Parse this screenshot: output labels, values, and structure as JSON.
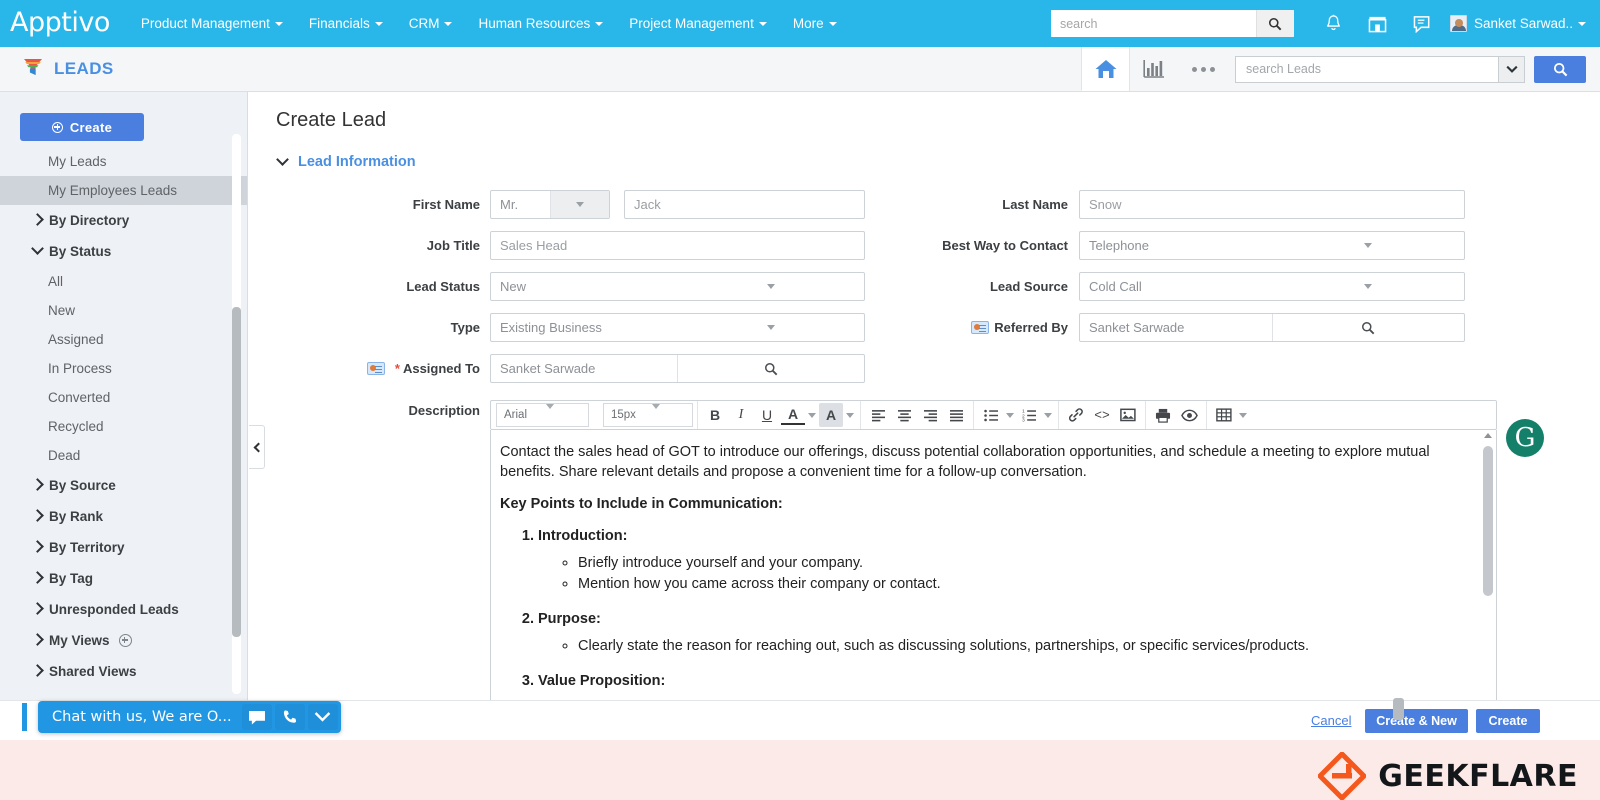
{
  "topnav": {
    "logo": "Apptivo",
    "menu": [
      {
        "label": "Product Management"
      },
      {
        "label": "Financials"
      },
      {
        "label": "CRM"
      },
      {
        "label": "Human Resources"
      },
      {
        "label": "Project Management"
      },
      {
        "label": "More"
      }
    ],
    "search_placeholder": "search",
    "search_value": "",
    "icons": [
      "search-icon",
      "bell-icon",
      "store-icon",
      "feedback-icon"
    ],
    "user_name": "Sanket Sarwad.."
  },
  "modbar": {
    "title": "LEADS",
    "home_icon": "home-icon",
    "reports_icon": "bar-chart-icon",
    "more_icon": "ellipsis-icon",
    "search_placeholder": "search Leads",
    "search_value": ""
  },
  "sidebar": {
    "create_label": "Create",
    "items": [
      {
        "label": "My Leads",
        "type": "leaf",
        "selected": false
      },
      {
        "label": "My Employees Leads",
        "type": "leaf",
        "selected": true
      },
      {
        "label": "By Directory",
        "type": "group",
        "expanded": false
      },
      {
        "label": "By Status",
        "type": "group",
        "expanded": true
      },
      {
        "label": "All",
        "type": "leaf",
        "selected": false
      },
      {
        "label": "New",
        "type": "leaf",
        "selected": false
      },
      {
        "label": "Assigned",
        "type": "leaf",
        "selected": false
      },
      {
        "label": "In Process",
        "type": "leaf",
        "selected": false
      },
      {
        "label": "Converted",
        "type": "leaf",
        "selected": false
      },
      {
        "label": "Recycled",
        "type": "leaf",
        "selected": false
      },
      {
        "label": "Dead",
        "type": "leaf",
        "selected": false
      },
      {
        "label": "By Source",
        "type": "group",
        "expanded": false
      },
      {
        "label": "By Rank",
        "type": "group",
        "expanded": false
      },
      {
        "label": "By Territory",
        "type": "group",
        "expanded": false
      },
      {
        "label": "By Tag",
        "type": "group",
        "expanded": false
      },
      {
        "label": "Unresponded Leads",
        "type": "group",
        "expanded": false
      },
      {
        "label": "My Views",
        "type": "group",
        "expanded": false,
        "add": true
      },
      {
        "label": "Shared Views",
        "type": "group",
        "expanded": false
      }
    ]
  },
  "main": {
    "page_title": "Create Lead",
    "section_title": "Lead Information",
    "fields": {
      "first_name_label": "First Name",
      "salutation_value": "Mr.",
      "first_name_value": "Jack",
      "last_name_label": "Last Name",
      "last_name_value": "Snow",
      "job_title_label": "Job Title",
      "job_title_value": "Sales Head",
      "best_way_label": "Best Way to Contact",
      "best_way_value": "Telephone",
      "lead_status_label": "Lead Status",
      "lead_status_value": "New",
      "lead_source_label": "Lead Source",
      "lead_source_value": "Cold Call",
      "type_label": "Type",
      "type_value": "Existing Business",
      "referred_by_label": "Referred By",
      "referred_by_value": "Sanket Sarwade",
      "assigned_to_label": "Assigned To",
      "assigned_to_value": "Sanket Sarwade",
      "assigned_to_required": "*",
      "description_label": "Description"
    },
    "editor": {
      "font_family_value": "Arial",
      "font_size_value": "15px",
      "buttons": [
        "bold-icon",
        "italic-icon",
        "underline-icon",
        "text-color-icon",
        "highlight-color-icon",
        "align-left-icon",
        "align-center-icon",
        "align-right-icon",
        "align-justify-icon",
        "bulleted-list-icon",
        "numbered-list-icon",
        "link-icon",
        "code-icon",
        "image-icon",
        "print-icon",
        "preview-icon",
        "table-icon"
      ],
      "content": {
        "intro": "Contact the sales head of GOT to introduce our offerings, discuss potential collaboration opportunities, and schedule a meeting to explore mutual benefits. Share relevant details and propose a convenient time for a follow-up conversation.",
        "heading": "Key Points to Include in Communication:",
        "item1_title": "Introduction:",
        "item1_bullets": [
          "Briefly introduce yourself and your company.",
          "Mention how you came across their company or contact."
        ],
        "item2_title": "Purpose:",
        "item2_bullets": [
          "Clearly state the reason for reaching out, such as discussing solutions, partnerships, or specific services/products."
        ],
        "item3_title": "Value Proposition:"
      }
    }
  },
  "footer": {
    "cancel_label": "Cancel",
    "create_new_label": "Create & New",
    "create_label": "Create"
  },
  "chat": {
    "text": "Chat with us, We are O...",
    "icons": [
      "chat-bubble-icon",
      "phone-icon",
      "chevron-down-icon"
    ]
  },
  "overlays": {
    "grammarly_icon": "grammarly-icon",
    "grammarly_letter": "G",
    "brand_name": "GEEKFLARE"
  },
  "colors": {
    "topnav_bg": "#29b6e8",
    "accent_blue": "#4a7fe0",
    "link_blue": "#4a90e2",
    "sidebar_bg": "#eef1f5",
    "brand_orange": "#f4581c",
    "grammarly_green": "#15806a"
  }
}
